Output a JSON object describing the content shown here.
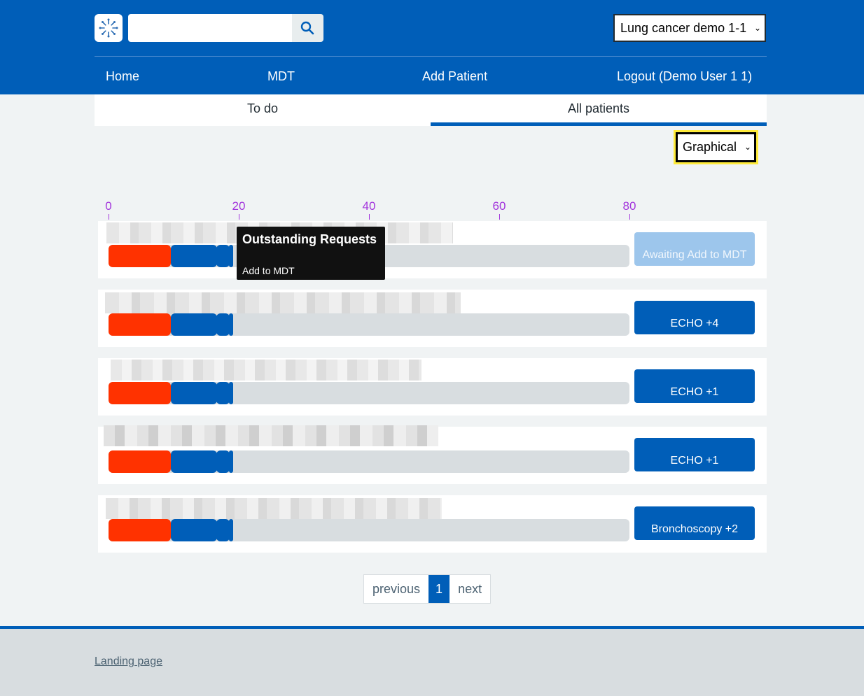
{
  "header": {
    "search_placeholder": "",
    "org_select": "Lung cancer demo 1-1",
    "nav": [
      "Home",
      "MDT",
      "Add Patient",
      "Logout (Demo User 1 1)"
    ]
  },
  "tabs": [
    "To do",
    "All patients"
  ],
  "view_select": "Graphical",
  "axis_ticks": [
    "0",
    "20",
    "40",
    "60",
    "80"
  ],
  "rows": [
    {
      "status": "Awaiting Add to MDT",
      "progress_days": [
        0,
        9.5,
        16.6,
        18.6,
        19.2
      ]
    },
    {
      "status": "ECHO +4",
      "progress_days": [
        0,
        9.5,
        16.6,
        18.6,
        19.2
      ]
    },
    {
      "status": "ECHO +1",
      "progress_days": [
        0,
        9.5,
        16.6,
        18.6,
        19.2
      ]
    },
    {
      "status": "ECHO +1",
      "progress_days": [
        0,
        9.5,
        16.6,
        18.6,
        19.2
      ]
    },
    {
      "status": "Bronchoscopy +2",
      "progress_days": [
        0,
        9.5,
        16.6,
        18.6,
        19.2
      ]
    }
  ],
  "tooltip": {
    "title": "Outstanding Requests",
    "item": "Add to MDT"
  },
  "pagination": {
    "previous": "previous",
    "current": "1",
    "next": "next"
  },
  "footer": {
    "link": "Landing page"
  },
  "colors": {
    "brand": "#005eb8",
    "alert": "#ff3200",
    "axis": "#a335dc",
    "highlight": "#ffeb3b"
  }
}
